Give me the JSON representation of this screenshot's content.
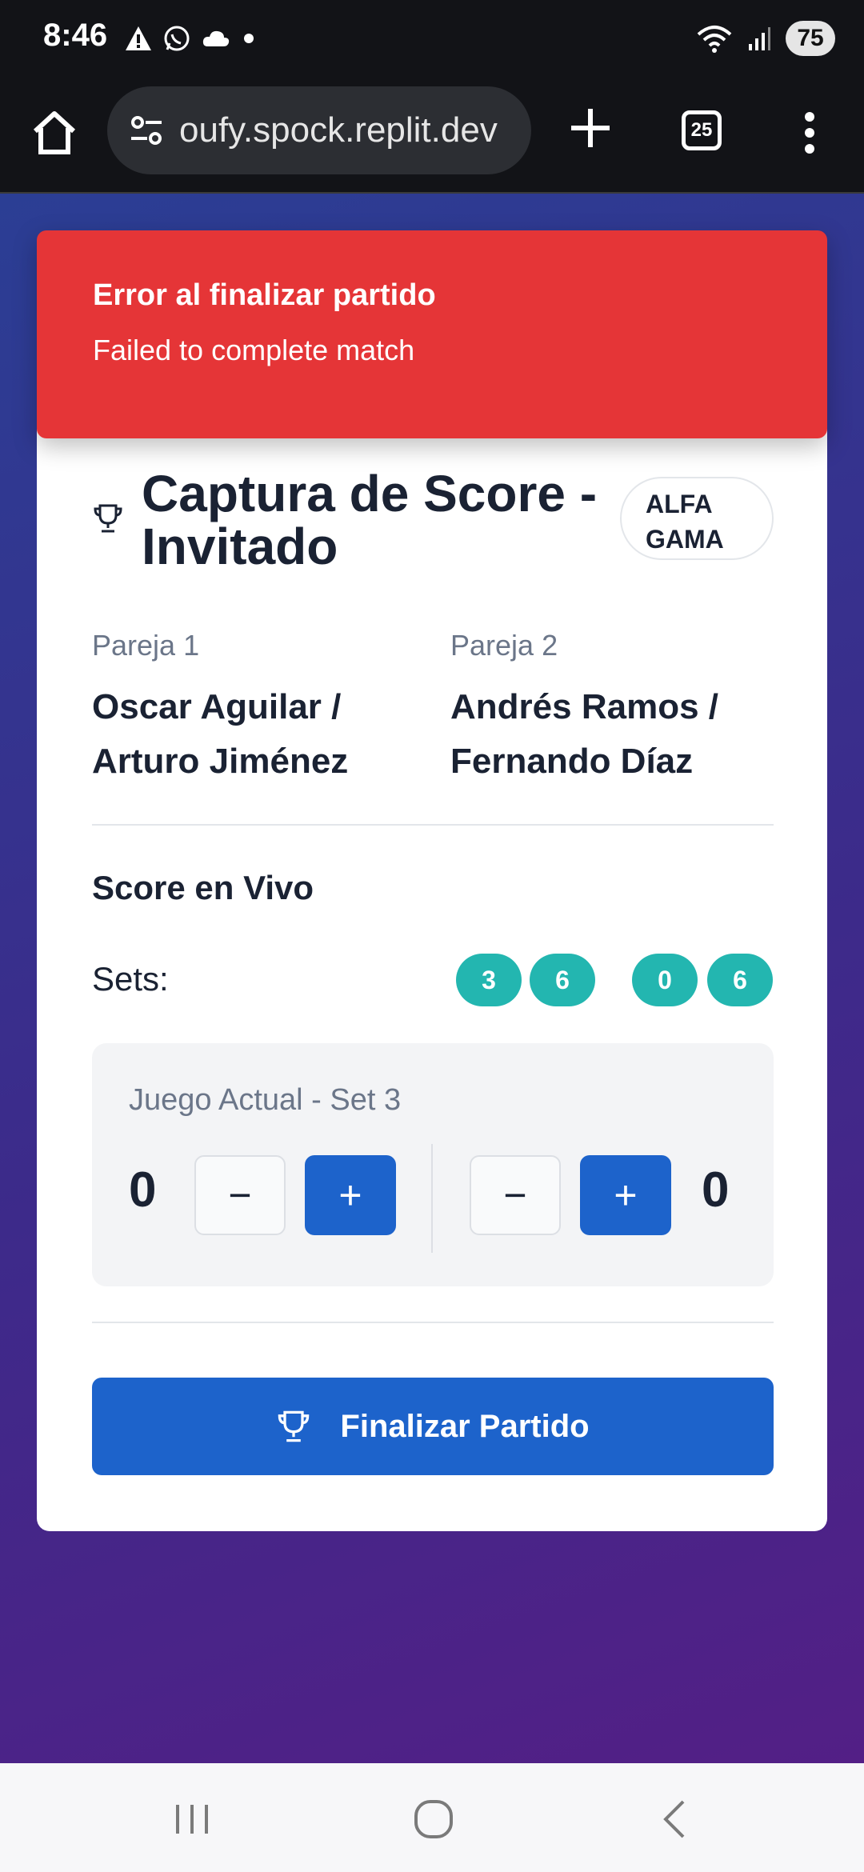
{
  "status_bar": {
    "time": "8:46",
    "battery": "75"
  },
  "browser": {
    "url": "oufy.spock.replit.dev",
    "tab_count": "25"
  },
  "toast": {
    "title": "Error al finalizar partido",
    "description": "Failed to complete match"
  },
  "header": {
    "title": "Captura de Score - Invitado",
    "badge": "ALFA GAMA"
  },
  "pairs": [
    {
      "label": "Pareja 1",
      "names": "Oscar Aguilar / Arturo Jiménez"
    },
    {
      "label": "Pareja 2",
      "names": "Andrés Ramos / Fernando Díaz"
    }
  ],
  "score": {
    "heading": "Score en Vivo",
    "sets_label": "Sets:",
    "sets": [
      "3",
      "6",
      "0",
      "6"
    ],
    "current_game_label": "Juego Actual - Set 3",
    "team1_points": "0",
    "team2_points": "0",
    "minus_label": "−",
    "plus_label": "+"
  },
  "actions": {
    "finalize_label": "Finalizar Partido"
  },
  "colors": {
    "accent": "#1d63cb",
    "error": "#e53537",
    "set_chip": "#23b6b0"
  }
}
